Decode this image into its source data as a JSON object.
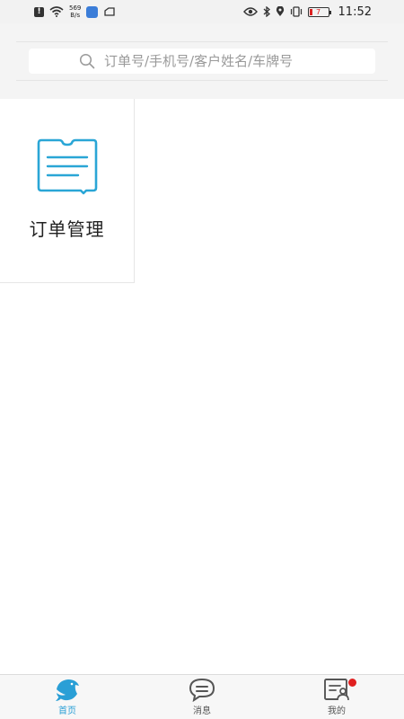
{
  "statusbar": {
    "speed_value": "569",
    "speed_unit": "B/s",
    "battery": "7",
    "time": "11:52"
  },
  "search": {
    "placeholder": "订单号/手机号/客户姓名/车牌号"
  },
  "grid": {
    "items": [
      {
        "label": "订单管理",
        "icon": "order-document-icon"
      }
    ]
  },
  "tabbar": {
    "items": [
      {
        "label": "首页",
        "icon": "dolphin-home-icon",
        "active": true
      },
      {
        "label": "消息",
        "icon": "message-bubble-icon",
        "active": false
      },
      {
        "label": "我的",
        "icon": "profile-card-icon",
        "active": false,
        "badge": true
      }
    ]
  },
  "colors": {
    "accent": "#2a9fd6",
    "badge": "#e02020",
    "header_bg": "#f4f4f4"
  }
}
